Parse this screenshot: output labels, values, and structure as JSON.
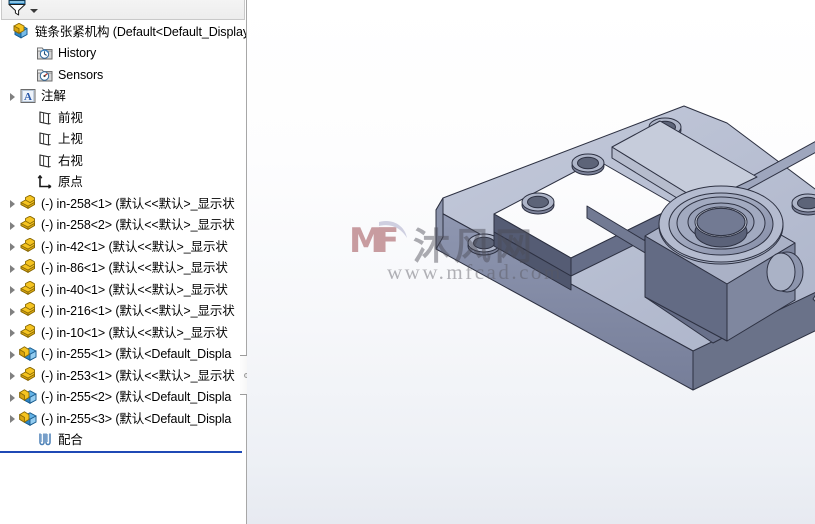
{
  "panel": {
    "filter": {
      "icon": "filter-funnel-icon",
      "dropdown_icon": "chevron-down-icon",
      "placeholder": ""
    },
    "tree": [
      {
        "label": "链条张紧机构  (Default<Default_Display",
        "icon": "assembly-icon",
        "indent": 0,
        "arrow": false
      },
      {
        "label": "History",
        "icon": "history-folder-icon",
        "indent": 2,
        "arrow": false
      },
      {
        "label": "Sensors",
        "icon": "sensors-folder-icon",
        "indent": 2,
        "arrow": false
      },
      {
        "label": "注解",
        "icon": "annotations-icon",
        "indent": 1,
        "arrow": true
      },
      {
        "label": "前视",
        "icon": "plane-icon",
        "indent": 2,
        "arrow": false
      },
      {
        "label": "上视",
        "icon": "plane-icon",
        "indent": 2,
        "arrow": false
      },
      {
        "label": "右视",
        "icon": "plane-icon",
        "indent": 2,
        "arrow": false
      },
      {
        "label": "原点",
        "icon": "origin-icon",
        "indent": 2,
        "arrow": false
      },
      {
        "label": "(-) in-258<1>  (默认<<默认>_显示状",
        "icon": "part-icon",
        "indent": 1,
        "arrow": true
      },
      {
        "label": "(-) in-258<2>  (默认<<默认>_显示状",
        "icon": "part-icon",
        "indent": 1,
        "arrow": true
      },
      {
        "label": "(-) in-42<1>  (默认<<默认>_显示状",
        "icon": "part-icon",
        "indent": 1,
        "arrow": true
      },
      {
        "label": "(-) in-86<1>  (默认<<默认>_显示状",
        "icon": "part-icon",
        "indent": 1,
        "arrow": true
      },
      {
        "label": "(-) in-40<1>  (默认<<默认>_显示状",
        "icon": "part-icon",
        "indent": 1,
        "arrow": true
      },
      {
        "label": "(-) in-216<1>  (默认<<默认>_显示状",
        "icon": "part-icon",
        "indent": 1,
        "arrow": true
      },
      {
        "label": "(-) in-10<1>  (默认<<默认>_显示状",
        "icon": "part-icon",
        "indent": 1,
        "arrow": true
      },
      {
        "label": "(-) in-255<1>  (默认<Default_Displa",
        "icon": "subassembly-icon",
        "indent": 1,
        "arrow": true
      },
      {
        "label": "(-) in-253<1>  (默认<<默认>_显示状",
        "icon": "part-icon",
        "indent": 1,
        "arrow": true
      },
      {
        "label": "(-) in-255<2>  (默认<Default_Displa",
        "icon": "subassembly-icon",
        "indent": 1,
        "arrow": true
      },
      {
        "label": "(-) in-255<3>  (默认<Default_Displa",
        "icon": "subassembly-icon",
        "indent": 1,
        "arrow": true
      },
      {
        "label": "配合",
        "icon": "mates-icon",
        "indent": 2,
        "arrow": false
      }
    ],
    "splitter": {
      "name": "panel-splitter-handle"
    }
  },
  "viewport": {
    "model_name": "链条张紧机构",
    "watermark": {
      "text": "沐风网",
      "url": "www.mfcad.com",
      "logo": "mf-logo-icon"
    }
  },
  "colors": {
    "accent_blue": "#1f49b5",
    "part_yellow": "#f0bf1e",
    "subassembly_blue": "#3d8fd1",
    "model_face_light": "#b9bfd2",
    "model_face_mid": "#9aa2bb",
    "model_face_dark": "#6e7690",
    "viewport_bg_top": "#ffffff",
    "viewport_bg_bottom": "#e7eaf1",
    "panel_border": "#a7a7a7"
  }
}
